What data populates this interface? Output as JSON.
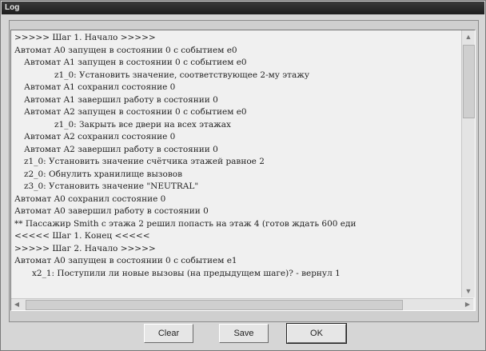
{
  "window": {
    "title": "Log"
  },
  "log": {
    "lines": [
      {
        "text": ">>>>> Шаг 1. Начало >>>>>",
        "indent": 0
      },
      {
        "text": "Автомат A0 запущен в состоянии 0 с событием e0",
        "indent": 0
      },
      {
        "text": "Автомат A1 запущен в состоянии 0 с событием e0",
        "indent": 1
      },
      {
        "text": "z1_0: Установить значение, соответствующее 2-му этажу",
        "indent": 3
      },
      {
        "text": "Автомат A1 сохранил состояние 0",
        "indent": 1
      },
      {
        "text": "Автомат A1 завершил работу в состоянии 0",
        "indent": 1
      },
      {
        "text": "Автомат A2 запущен в состоянии 0 с событием e0",
        "indent": 1
      },
      {
        "text": "z1_0: Закрыть все двери на всех этажах",
        "indent": 3
      },
      {
        "text": "Автомат A2 сохранил состояние 0",
        "indent": 1
      },
      {
        "text": "Автомат A2 завершил работу в состоянии 0",
        "indent": 1
      },
      {
        "text": "z1_0: Установить значение счётчика этажей равное 2",
        "indent": 1
      },
      {
        "text": "z2_0: Обнулить хранилище вызовов",
        "indent": 1
      },
      {
        "text": "z3_0: Установить значение \"NEUTRAL\"",
        "indent": 1
      },
      {
        "text": "Автомат A0 сохранил состояние 0",
        "indent": 0
      },
      {
        "text": "Автомат A0 завершил работу в состоянии 0",
        "indent": 0
      },
      {
        "text": "** Пассажир Smith с этажа 2 решил попасть на этаж 4 (готов ждать 600 еди",
        "indent": 0
      },
      {
        "text": "<<<<< Шаг 1. Конец <<<<<",
        "indent": 0
      },
      {
        "text": ">>>>> Шаг 2. Начало >>>>>",
        "indent": 0
      },
      {
        "text": "Автомат A0 запущен в состоянии 0 с событием e1",
        "indent": 0
      },
      {
        "text": "x2_1: Поступили ли новые вызовы (на предыдущем шаге)? - вернул 1",
        "indent": 2
      },
      {
        "text": "",
        "indent": 0
      }
    ]
  },
  "buttons": {
    "clear": "Clear",
    "save": "Save",
    "ok": "OK"
  },
  "icons": {
    "scroll_up": "▲",
    "scroll_down": "▼",
    "scroll_left": "◀",
    "scroll_right": "▶"
  }
}
